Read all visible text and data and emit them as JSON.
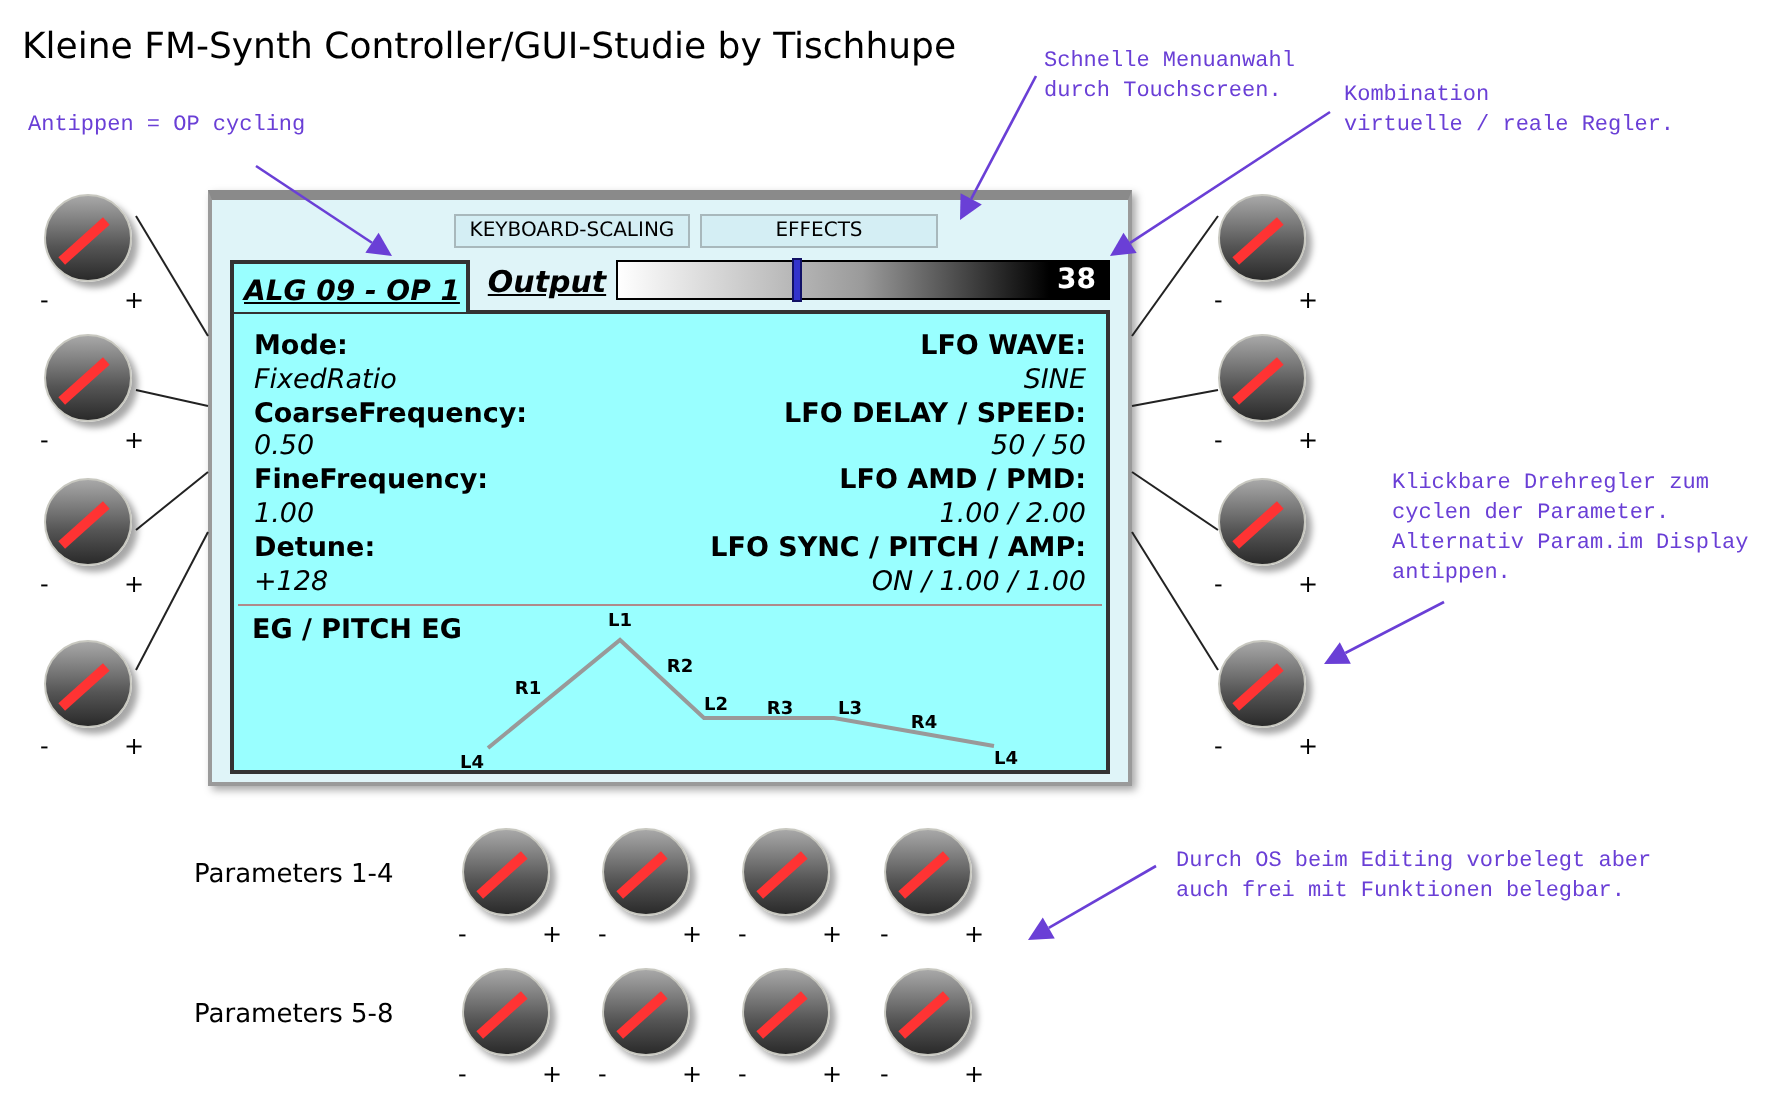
{
  "title": "Kleine FM-Synth Controller/GUI-Studie by Tischhupe",
  "annotations": [
    {
      "text": "Antippen = OP cycling"
    },
    {
      "text": "Schnelle Menuanwahl\ndurch Touchscreen."
    },
    {
      "text": "Kombination\nvirtuelle / reale Regler."
    },
    {
      "text": "Klickbare Drehregler zum\ncyclen der Parameter.\nAlternativ Param.im Display\nantippen."
    },
    {
      "text": "Durch OS beim Editing vorbelegt aber\nauch frei mit Funktionen belegbar."
    }
  ],
  "left_knobs": [
    {
      "minus": "-",
      "plus": "+"
    },
    {
      "minus": "-",
      "plus": "+"
    },
    {
      "minus": "-",
      "plus": "+"
    },
    {
      "minus": "-",
      "plus": "+"
    }
  ],
  "right_knobs": [
    {
      "minus": "-",
      "plus": "+"
    },
    {
      "minus": "-",
      "plus": "+"
    },
    {
      "minus": "-",
      "plus": "+"
    },
    {
      "minus": "-",
      "plus": "+"
    }
  ],
  "display": {
    "menu_buttons": [
      "KEYBOARD-SCALING",
      "EFFECTS"
    ],
    "op_tab": "ALG 09 - OP 1",
    "output": {
      "label": "Output",
      "level": 0.35,
      "value": "38"
    },
    "params_left": [
      {
        "label": "Mode:",
        "value": "FixedRatio"
      },
      {
        "label": "CoarseFrequency:",
        "value": "0.50"
      },
      {
        "label": "FineFrequency:",
        "value": "1.00"
      },
      {
        "label": "Detune:",
        "value": "+128"
      }
    ],
    "params_right": [
      {
        "label": "LFO WAVE:",
        "value": "SINE"
      },
      {
        "label": "LFO DELAY / SPEED:",
        "value": "50 / 50"
      },
      {
        "label": "LFO AMD / PMD:",
        "value": "1.00 / 2.00"
      },
      {
        "label": "LFO SYNC / PITCH / AMP:",
        "value": "ON / 1.00 / 1.00"
      }
    ],
    "eg": {
      "title": "EG / PITCH EG",
      "labels": [
        "L4",
        "R1",
        "L1",
        "R2",
        "L2",
        "R3",
        "L3",
        "R4",
        "L4"
      ]
    }
  },
  "parameter_rows": [
    {
      "label": "Parameters 1-4",
      "knobs": [
        {
          "minus": "-",
          "plus": "+"
        },
        {
          "minus": "-",
          "plus": "+"
        },
        {
          "minus": "-",
          "plus": "+"
        },
        {
          "minus": "-",
          "plus": "+"
        }
      ]
    },
    {
      "label": "Parameters 5-8",
      "knobs": [
        {
          "minus": "-",
          "plus": "+"
        },
        {
          "minus": "-",
          "plus": "+"
        },
        {
          "minus": "-",
          "plus": "+"
        },
        {
          "minus": "-",
          "plus": "+"
        }
      ]
    }
  ]
}
